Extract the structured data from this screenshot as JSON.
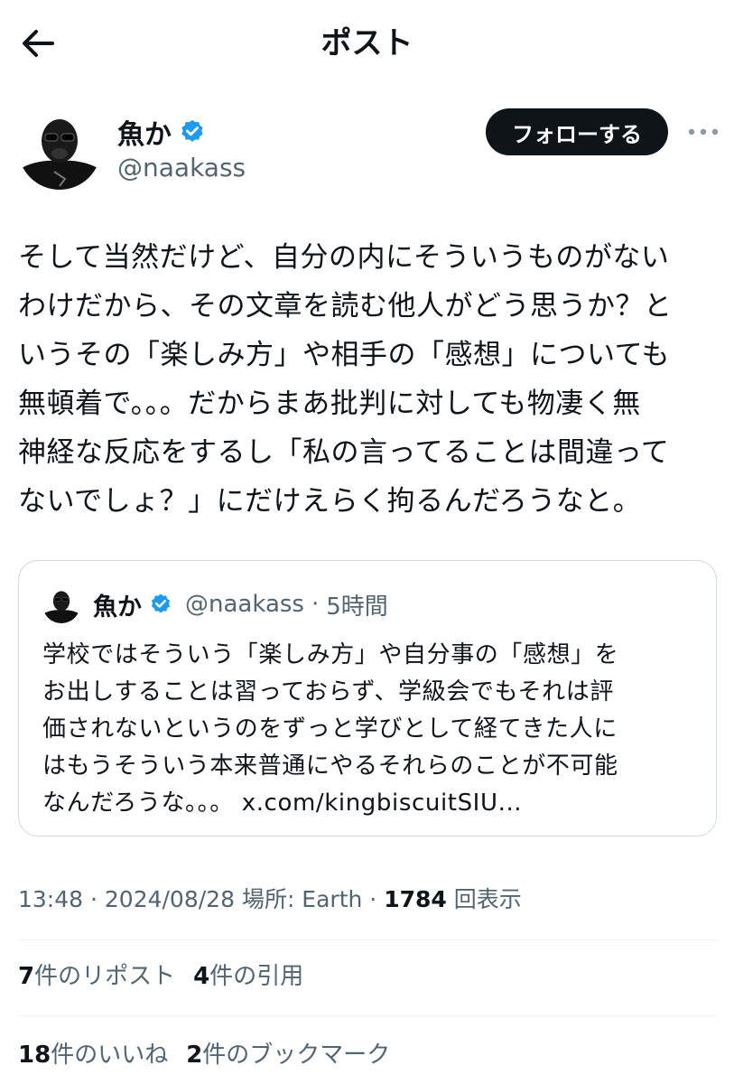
{
  "header": {
    "title": "ポスト"
  },
  "author": {
    "display_name": "魚か",
    "handle": "@naakass",
    "follow_label": "フォローする"
  },
  "tweet": {
    "text": "そして当然だけど、自分の内にそういうものがない\nわけだから、その文章を読む他人がどう思うか？と\nいうその「楽しみ方」や相手の「感想」についても\n無頓着で。。。だからまあ批判に対しても物凄く無\n神経な反応をするし「私の言ってることは間違って\nないでしょ？」にだけえらく拘るんだろうなと。"
  },
  "quote": {
    "display_name": "魚か",
    "handle": "@naakass",
    "separator": "·",
    "time": "5時間",
    "text": "学校ではそういう「楽しみ方」や自分事の「感想」を\nお出しすることは習っておらず、学級会でもそれは評\n価されないというのをずっと学びとして経てきた人に\nはもうそういう本来普通にやるそれらのことが不可能\nなんだろうな。。。 x.com/kingbiscuitSIU..."
  },
  "meta": {
    "time": "13:48",
    "sep": " · ",
    "date": "2024/08/28",
    "location": "場所: Earth",
    "views_count": "1784",
    "views_label": "回表示"
  },
  "stats": {
    "reposts_count": "7",
    "reposts_label": "件のリポスト",
    "quotes_count": "4",
    "quotes_label": "件の引用",
    "likes_count": "18",
    "likes_label": "件のいいね",
    "bookmarks_count": "2",
    "bookmarks_label": "件のブックマーク"
  },
  "colors": {
    "text": "#0f1419",
    "secondary": "#536471",
    "verified": "#1d9bf0",
    "border": "#cfd9de",
    "follow_bg": "#0f1419"
  },
  "icons": {
    "back": "arrow-left-icon",
    "verified": "verified-badge-icon",
    "more": "more-horizontal-icon"
  }
}
